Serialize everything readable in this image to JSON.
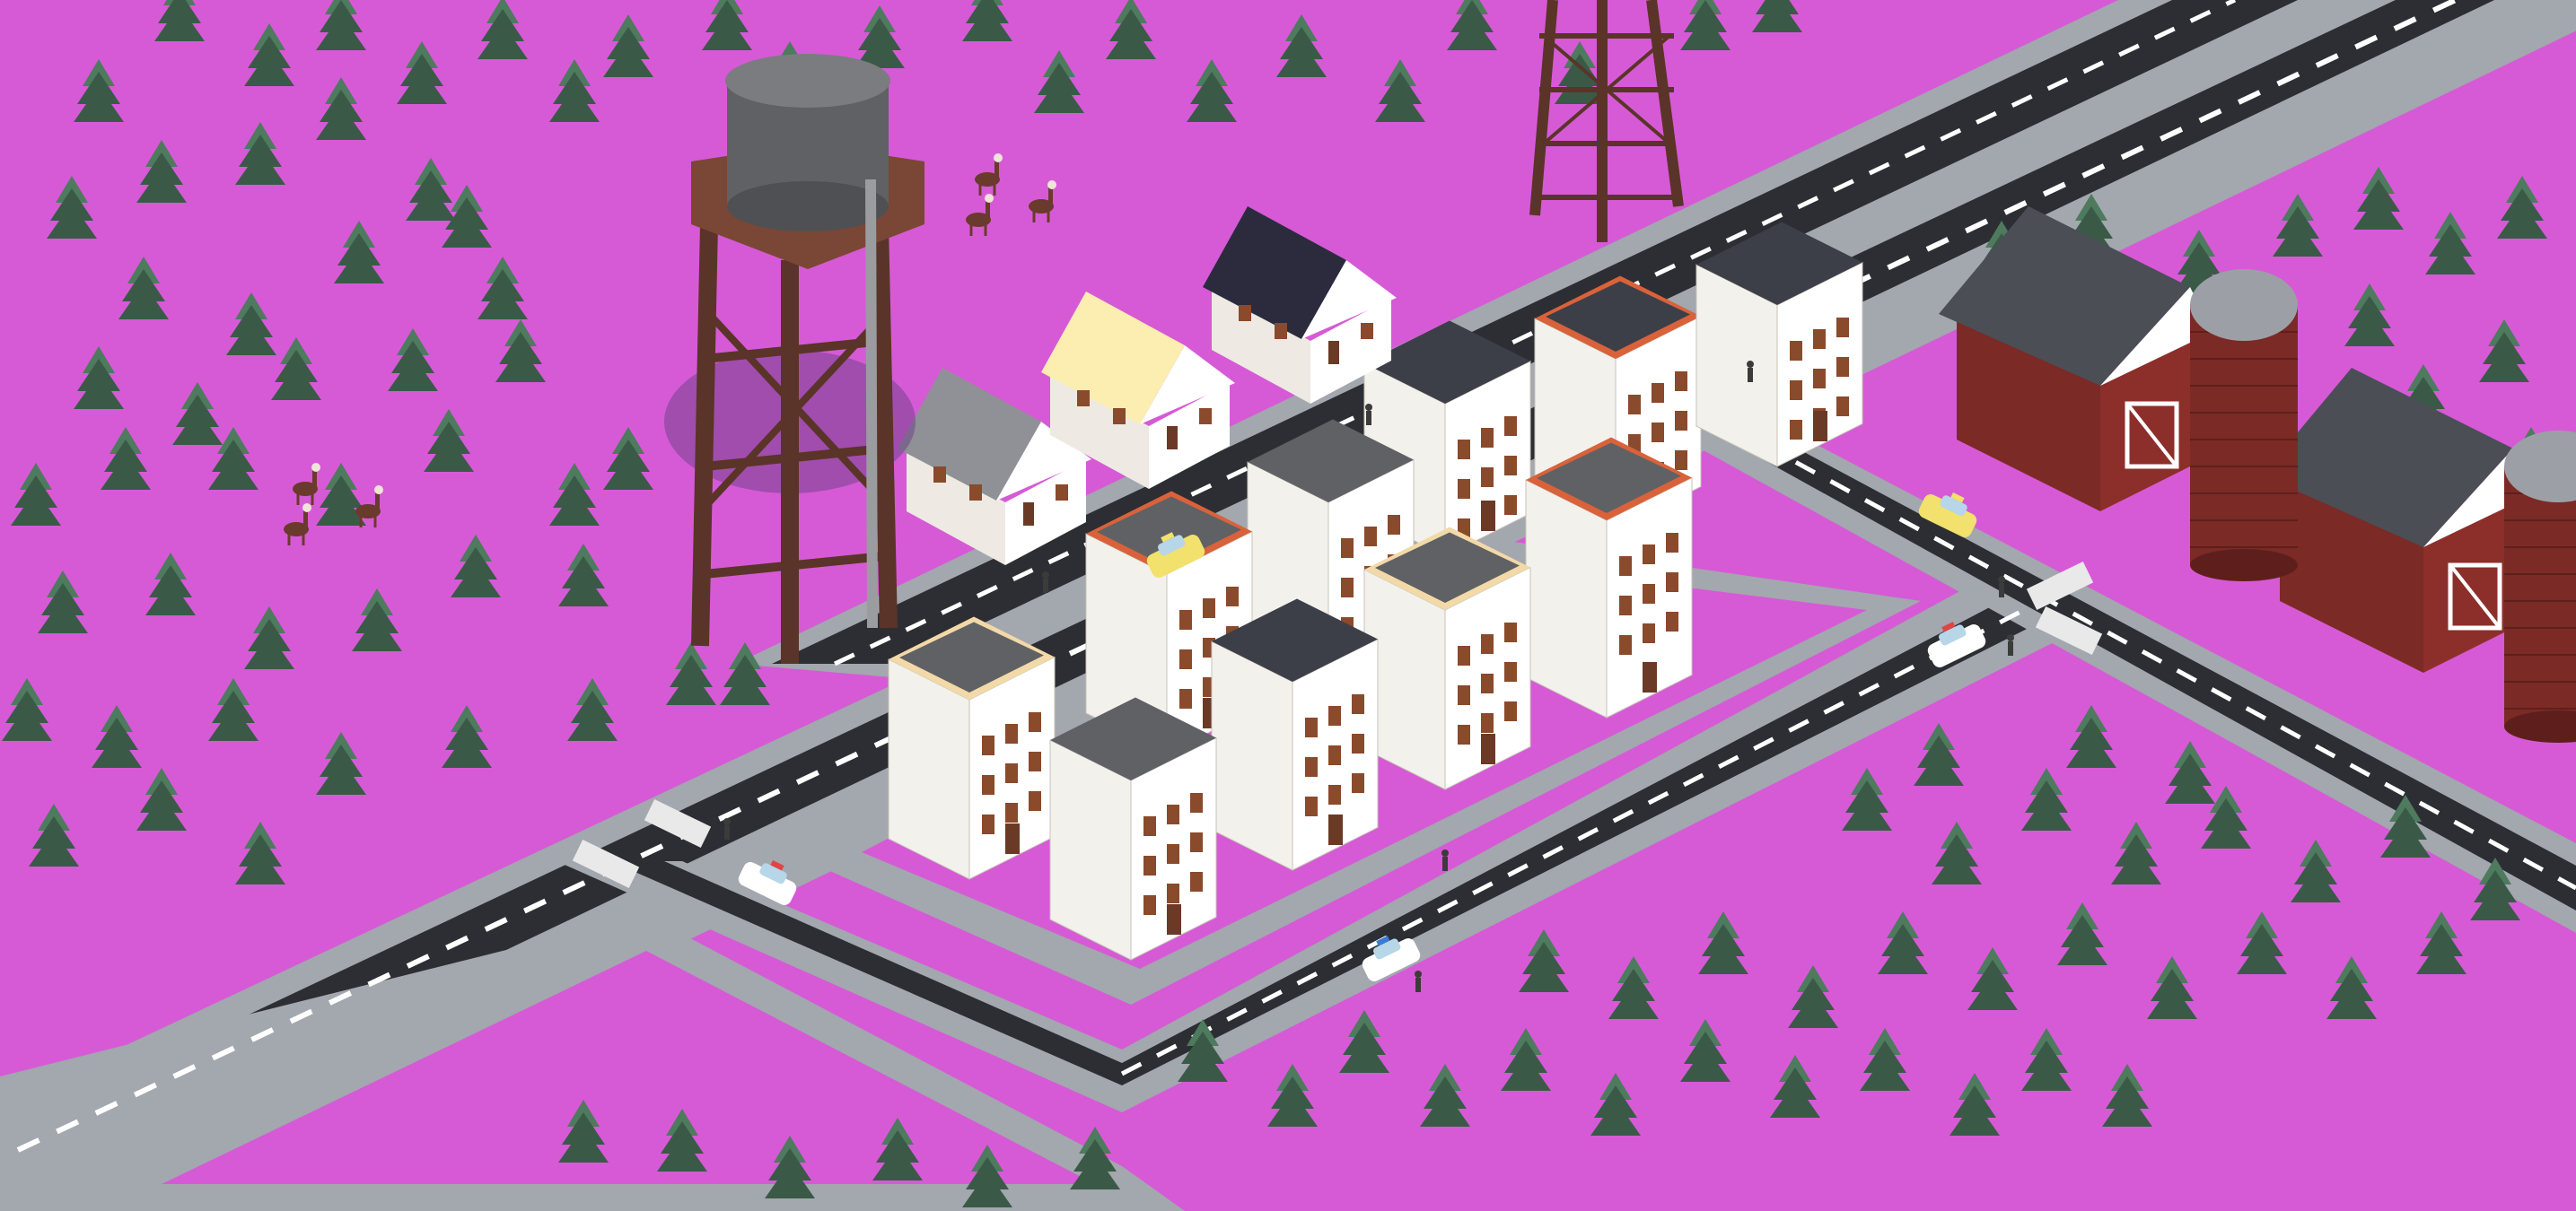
{
  "scene": {
    "title": "",
    "view": "isometric town",
    "colors": {
      "ground": "#d65ad6",
      "sidewalk": "#a3a7ae",
      "road": "#2d2e33",
      "lane_marking": "#ffffff",
      "tree": "#3a5a47",
      "tree_light": "#4e7a5e",
      "building_wall": "#f3f1ec",
      "roof_dark": "#3d3f48",
      "roof_trim_orange": "#d9623a",
      "roof_trim_cream": "#f2d9a7",
      "barn_wall": "#7b2a26",
      "barn_roof": "#4b4e55",
      "silo": "#7b2a26",
      "silo_cap": "#9ca0a6",
      "tower_wood": "#5a3428",
      "tank_gray": "#5f6165",
      "house_roof_cream": "#fbeeb0",
      "house_roof_navy": "#2b2b3d",
      "house_roof_gray": "#8f9196"
    },
    "objects": {
      "water_tower": "water-tower",
      "radio_tower": "lattice-tower",
      "houses": [
        "gray-roof-house",
        "cream-roof-house",
        "navy-roof-house"
      ],
      "apartment_count": 11,
      "barns": 2,
      "silos": 2,
      "vehicles": [
        "taxi",
        "police-car",
        "police-car",
        "police-car",
        "taxi"
      ],
      "animals": "llamas"
    }
  }
}
